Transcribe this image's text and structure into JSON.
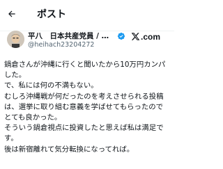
{
  "topbar": {
    "back_icon": "arrow-left-icon",
    "title": "ポスト"
  },
  "post": {
    "author": {
      "display_name": "平八　日本共産党員 / しん...",
      "handle": "@heihach23204272",
      "verified_icon": "verified-badge-icon",
      "verified_color": "#1d9bf0"
    },
    "brand": {
      "icon": "x-logo-icon",
      "wordmark": ".com"
    },
    "lines": [
      "鍋倉さんが沖縄に行くと聞いたから10万円カンパ",
      "した。",
      "で、私には何の不満もない。",
      "むしろ沖縄戦が何だったのを考えさせられる投稿",
      "は、選挙に取り組む意義を学ばせてもらったので",
      "とても良かった。",
      "そういう鍋倉視点に投資したと思えば私は満足で",
      "す。",
      "後は新宿離れて気分転換になってれば。"
    ]
  },
  "colors": {
    "text": "#0f1419",
    "secondary_text": "#536471",
    "divider": "#eff3f4"
  }
}
